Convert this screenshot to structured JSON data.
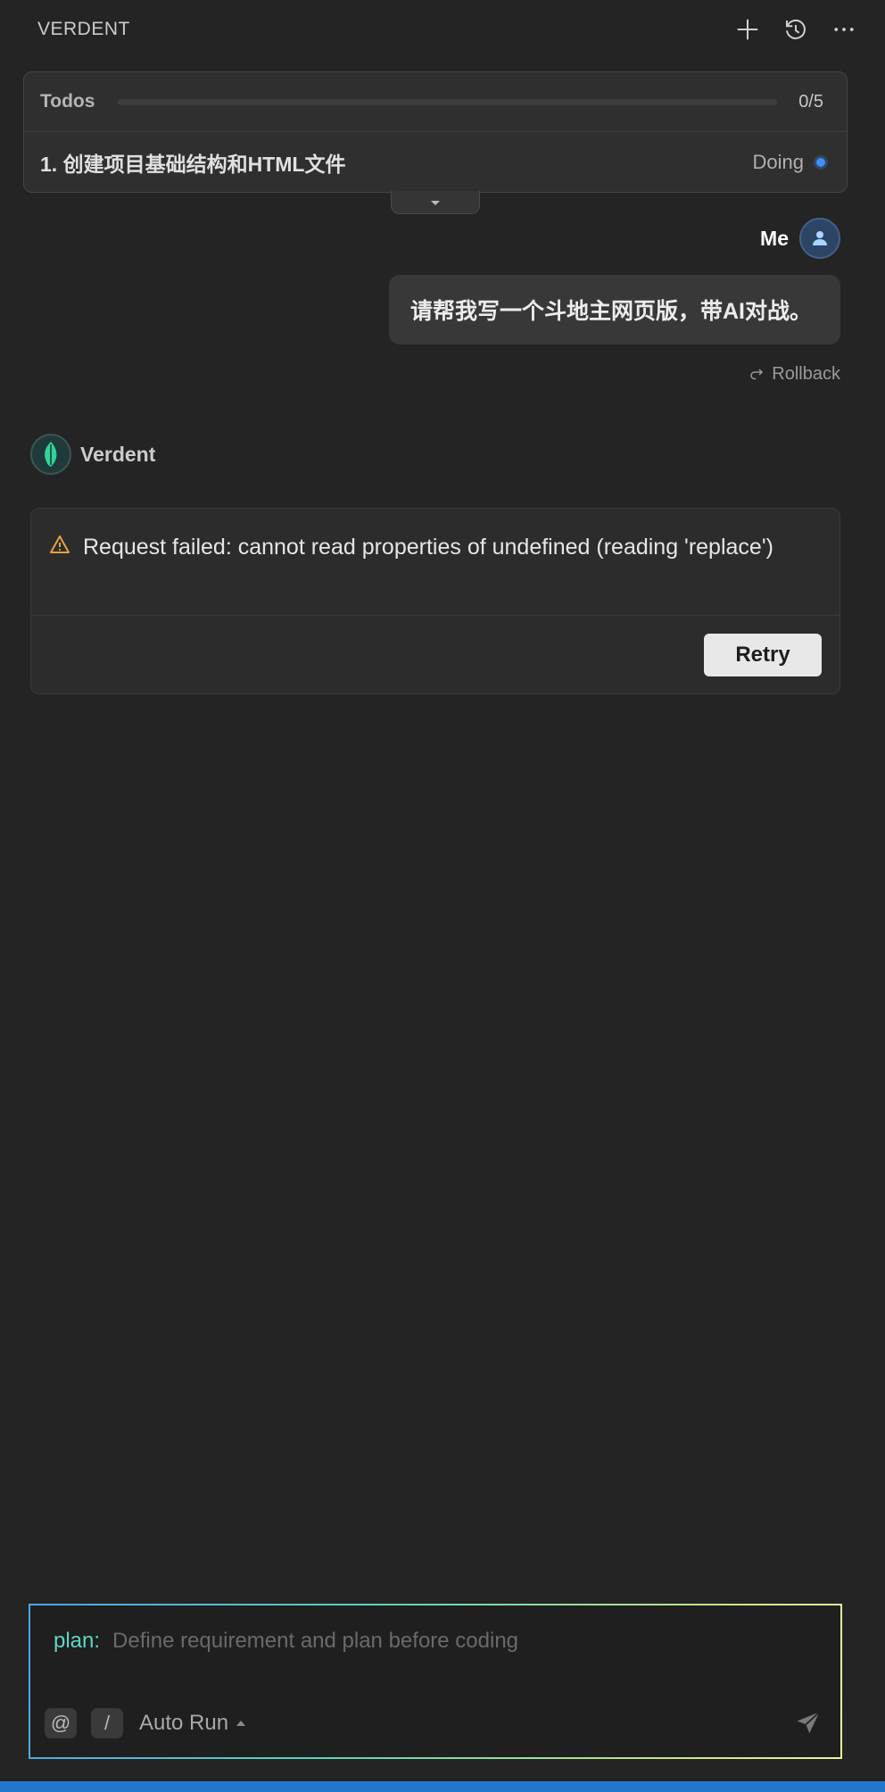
{
  "header": {
    "title": "VERDENT",
    "actions": [
      "plus-icon",
      "history-icon",
      "more-icon"
    ]
  },
  "todos": {
    "label": "Todos",
    "count": "0/5",
    "progress_fraction": 0,
    "current_item": "1. 创建项目基础结构和HTML文件",
    "current_status": "Doing"
  },
  "user_message": {
    "author": "Me",
    "text": "请帮我写一个斗地主网页版，带AI对战。",
    "rollback_label": "Rollback"
  },
  "agent": {
    "name": "Verdent",
    "error": {
      "message": "Request failed: cannot read properties of undefined (reading 'replace')",
      "retry_label": "Retry"
    }
  },
  "composer": {
    "mode_prefix": "plan:",
    "placeholder": "Define requirement and plan before coding",
    "mention_label": "@",
    "command_label": "/",
    "run_mode": "Auto Run"
  },
  "colors": {
    "background": "#242424",
    "accent_blue": "#3e8ef7",
    "warning": "#e8a33d",
    "plan_prefix": "#5fd6c4"
  }
}
